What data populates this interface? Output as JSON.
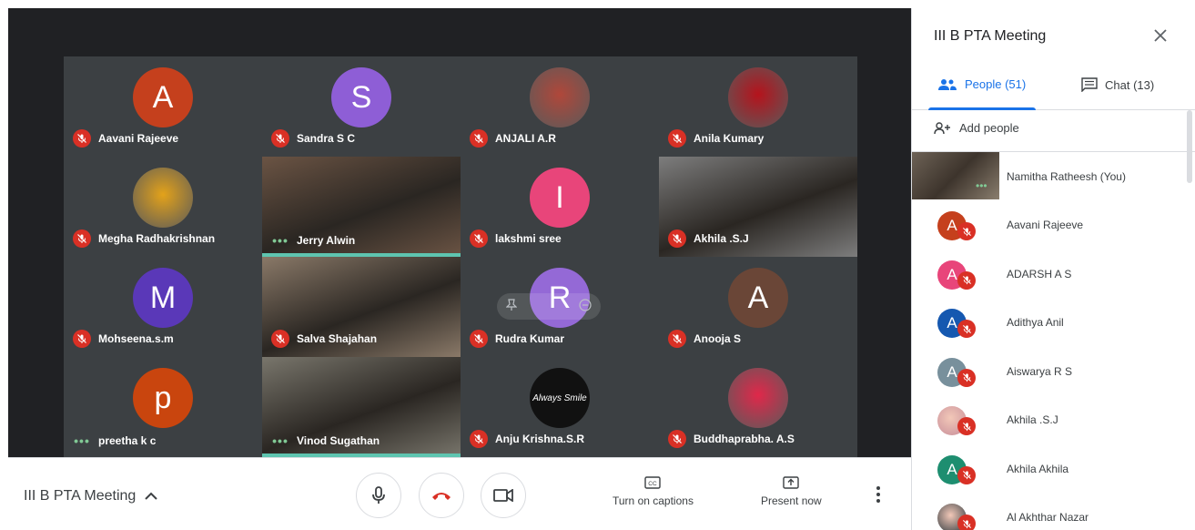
{
  "colors": {
    "mute_red": "#d93025",
    "accent_blue": "#1a73e8",
    "speaking_teal": "#5ec5b0",
    "end_call_red": "#d93025"
  },
  "grid": {
    "tiles": [
      {
        "name": "Aavani Rajeeve",
        "type": "avatar",
        "initial": "A",
        "color": "#c5401d",
        "status": "muted"
      },
      {
        "name": "Sandra S C",
        "type": "avatar",
        "initial": "S",
        "color": "#8e5ed6",
        "status": "muted"
      },
      {
        "name": "ANJALI A.R",
        "type": "photo",
        "initial": "",
        "color": "#b0473a",
        "status": "muted"
      },
      {
        "name": "Anila Kumary",
        "type": "photo",
        "initial": "",
        "color": "#b5131c",
        "status": "muted"
      },
      {
        "name": "Megha Radhakrishnan",
        "type": "photo",
        "initial": "",
        "color": "#e3a21a",
        "status": "muted"
      },
      {
        "name": "Jerry Alwin",
        "type": "video",
        "initial": "",
        "color": "#6b5444",
        "status": "speaking"
      },
      {
        "name": "lakshmi sree",
        "type": "avatar",
        "initial": "I",
        "color": "#e8457a",
        "status": "muted"
      },
      {
        "name": "Akhila .S.J",
        "type": "video",
        "initial": "",
        "color": "#7d7d7d",
        "status": "muted"
      },
      {
        "name": "Mohseena.s.m",
        "type": "avatar",
        "initial": "M",
        "color": "#5a38b8",
        "status": "muted"
      },
      {
        "name": "Salva Shajahan",
        "type": "video",
        "initial": "",
        "color": "#8a7968",
        "status": "muted"
      },
      {
        "name": "Rudra Kumar",
        "type": "avatar-pinned",
        "initial": "R",
        "color": "#9469d6",
        "status": "muted"
      },
      {
        "name": "Anooja S",
        "type": "avatar",
        "initial": "A",
        "color": "#6a4637",
        "status": "muted"
      },
      {
        "name": "preetha k c",
        "type": "avatar",
        "initial": "p",
        "color": "#c9450e",
        "status": "dots"
      },
      {
        "name": "Vinod Sugathan",
        "type": "video",
        "initial": "",
        "color": "#79766c",
        "status": "dots"
      },
      {
        "name": "Anju Krishna.S.R",
        "type": "photo-text",
        "initial": "",
        "color": "#111111",
        "status": "muted",
        "badge_text": "Always Smile"
      },
      {
        "name": "Buddhaprabha. A.S",
        "type": "photo",
        "initial": "",
        "color": "#e0284a",
        "status": "muted"
      }
    ]
  },
  "bottombar": {
    "meeting_title": "III B PTA Meeting",
    "captions_label": "Turn on captions",
    "present_label": "Present now"
  },
  "panel": {
    "title": "III B PTA Meeting",
    "people_tab": "People (51)",
    "chat_tab": "Chat (13)",
    "add_people": "Add people",
    "participants": [
      {
        "name": "Namitha Ratheesh (You)",
        "initial": "",
        "color": "#6d6256",
        "self": true
      },
      {
        "name": "Aavani Rajeeve",
        "initial": "A",
        "color": "#c5401d"
      },
      {
        "name": "ADARSH A S",
        "initial": "A",
        "color": "#e8457a"
      },
      {
        "name": "Adithya Anil",
        "initial": "A",
        "color": "#1558b0"
      },
      {
        "name": "Aiswarya R S",
        "initial": "A",
        "color": "#78909c"
      },
      {
        "name": "Akhila .S.J",
        "initial": "",
        "color": "#c78d9a"
      },
      {
        "name": "Akhila Akhila",
        "initial": "A",
        "color": "#1e8e70"
      },
      {
        "name": "Al Akhthar Nazar",
        "initial": "",
        "color": "#263238"
      }
    ]
  }
}
